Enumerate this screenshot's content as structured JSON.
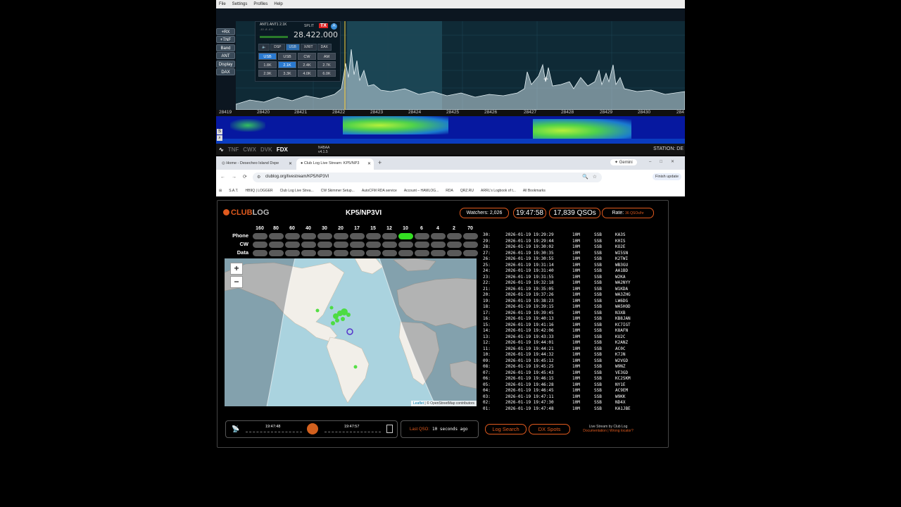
{
  "sdr": {
    "menu": [
      "File",
      "Settings",
      "Profiles",
      "Help"
    ],
    "side_buttons": [
      "+RX",
      "+TNF",
      "Band",
      "ANT",
      "Display",
      "DAX"
    ],
    "slice": {
      "ant": "ANT1 ANT1 2.1K",
      "sub": "-10 -8 -4 0",
      "split": "SPLIT",
      "tx": "TX",
      "letter": "A",
      "frequency": "28.422.000",
      "tabs": [
        "DSP",
        "USB",
        "X/RIT",
        "DAX"
      ],
      "filters": [
        "USB",
        "USB",
        "CW",
        "AM",
        "1.8K",
        "2.1K",
        "2.4K",
        "2.7K",
        "2.9K",
        "3.3K",
        "4.0K",
        "6.0K"
      ]
    },
    "freq_labels": [
      "28419",
      "28420",
      "28421",
      "28422",
      "28423",
      "28424",
      "28425",
      "28426",
      "28427",
      "28428",
      "28429",
      "28430",
      "284"
    ],
    "status": [
      "TNF",
      "CWX",
      "DVK",
      "FDX"
    ],
    "callsign": "N4BAA",
    "version": "v4.1.5",
    "station": "STATION: DE"
  },
  "browser": {
    "tabs": [
      {
        "title": "Home - Desecheo Island Dxpe"
      },
      {
        "title": "Club Log Live Stream: KP5/NP3"
      }
    ],
    "gemini": "Gemini",
    "url": "clublog.org/livestream/KP5/NP3VI",
    "finish_update": "Finish update",
    "bookmarks": [
      "S.A.T.",
      "HB9Q | LOGGER",
      "Club Log Live Strea...",
      "CW Skimmer Setup...",
      "AutoCFM RDA service",
      "Account – HAMLOG...",
      "RDA",
      "QRZ.RU",
      "ARRL's Logbook of t...",
      "All Bookmarks"
    ]
  },
  "clublog": {
    "logo_club": "CLUB",
    "logo_log": "LOG",
    "callsign": "KP5/NP3VI",
    "watchers": "Watchers: 2,026",
    "clock": "19:47:58",
    "qsos": "17,839 QSOs",
    "rate_label": "Rate:",
    "rate_value": "36 QSOs/hr",
    "bands": [
      "160",
      "80",
      "60",
      "40",
      "30",
      "20",
      "17",
      "15",
      "12",
      "10",
      "6",
      "4",
      "2",
      "70"
    ],
    "modes": [
      "Phone",
      "CW",
      "Data"
    ],
    "active": {
      "mode": "Phone",
      "band": "10"
    },
    "zoom_in": "+",
    "zoom_out": "−",
    "attribution_leaflet": "Leaflet",
    "attribution_rest": "| © OpenStreetMap contributors",
    "log": [
      {
        "n": "30:",
        "t": "2026-01-19 19:29:29",
        "b": "10M",
        "m": "SSB",
        "c": "KA3S"
      },
      {
        "n": "29:",
        "t": "2026-01-19 19:29:44",
        "b": "10M",
        "m": "SSB",
        "c": "K0IS"
      },
      {
        "n": "28:",
        "t": "2026-01-19 19:30:02",
        "b": "10M",
        "m": "SSB",
        "c": "KO2E"
      },
      {
        "n": "27:",
        "t": "2026-01-19 19:30:35",
        "b": "10M",
        "m": "SSB",
        "c": "WI5SN"
      },
      {
        "n": "26:",
        "t": "2026-01-19 19:30:55",
        "b": "10M",
        "m": "SSB",
        "c": "K2TWI"
      },
      {
        "n": "25:",
        "t": "2026-01-19 19:31:14",
        "b": "10M",
        "m": "SSB",
        "c": "WB3GU"
      },
      {
        "n": "24:",
        "t": "2026-01-19 19:31:40",
        "b": "10M",
        "m": "SSB",
        "c": "AA1BD"
      },
      {
        "n": "23:",
        "t": "2026-01-19 19:31:55",
        "b": "10M",
        "m": "SSB",
        "c": "W2KA"
      },
      {
        "n": "22:",
        "t": "2026-01-19 19:32:18",
        "b": "10M",
        "m": "SSB",
        "c": "WA2NYY"
      },
      {
        "n": "21:",
        "t": "2026-01-19 19:35:05",
        "b": "10M",
        "m": "SSB",
        "c": "W1KDA"
      },
      {
        "n": "20:",
        "t": "2026-01-19 19:37:26",
        "b": "10M",
        "m": "SSB",
        "c": "WA3ZHG"
      },
      {
        "n": "19:",
        "t": "2026-01-19 19:38:23",
        "b": "10M",
        "m": "SSB",
        "c": "LW6DG"
      },
      {
        "n": "18:",
        "t": "2026-01-19 19:39:15",
        "b": "10M",
        "m": "SSB",
        "c": "WA5HOD"
      },
      {
        "n": "17:",
        "t": "2026-01-19 19:39:45",
        "b": "10M",
        "m": "SSB",
        "c": "N3XB"
      },
      {
        "n": "16:",
        "t": "2026-01-19 19:40:13",
        "b": "10M",
        "m": "SSB",
        "c": "KB8JAN"
      },
      {
        "n": "15:",
        "t": "2026-01-19 19:41:16",
        "b": "10M",
        "m": "SSB",
        "c": "KC7IGT"
      },
      {
        "n": "14:",
        "t": "2026-01-19 19:42:06",
        "b": "10M",
        "m": "SSB",
        "c": "K8AFN"
      },
      {
        "n": "13:",
        "t": "2026-01-19 19:43:33",
        "b": "10M",
        "m": "SSB",
        "c": "KU2C"
      },
      {
        "n": "12:",
        "t": "2026-01-19 19:44:01",
        "b": "10M",
        "m": "SSB",
        "c": "K2ANZ"
      },
      {
        "n": "11:",
        "t": "2026-01-19 19:44:21",
        "b": "10M",
        "m": "SSB",
        "c": "AC0C"
      },
      {
        "n": "10:",
        "t": "2026-01-19 19:44:32",
        "b": "10M",
        "m": "SSB",
        "c": "K7JN"
      },
      {
        "n": "09:",
        "t": "2026-01-19 19:45:12",
        "b": "10M",
        "m": "SSB",
        "c": "W2VGD"
      },
      {
        "n": "08:",
        "t": "2026-01-19 19:45:25",
        "b": "10M",
        "m": "SSB",
        "c": "W9NZ"
      },
      {
        "n": "07:",
        "t": "2026-01-19 19:45:43",
        "b": "10M",
        "m": "SSB",
        "c": "VE3GD"
      },
      {
        "n": "06:",
        "t": "2026-01-19 19:46:15",
        "b": "10M",
        "m": "SSB",
        "c": "KC2SKM"
      },
      {
        "n": "05:",
        "t": "2026-01-19 19:46:28",
        "b": "10M",
        "m": "SSB",
        "c": "NY1E"
      },
      {
        "n": "04:",
        "t": "2026-01-19 19:46:45",
        "b": "10M",
        "m": "SSB",
        "c": "AC9EM"
      },
      {
        "n": "03:",
        "t": "2026-01-19 19:47:11",
        "b": "10M",
        "m": "SSB",
        "c": "W9KK"
      },
      {
        "n": "02:",
        "t": "2026-01-19 19:47:30",
        "b": "10M",
        "m": "SSB",
        "c": "ND4X"
      },
      {
        "n": "01:",
        "t": "2026-01-19 19:47:48",
        "b": "10M",
        "m": "SSB",
        "c": "KA1JBE"
      }
    ],
    "player": {
      "time_left": "19:47:48",
      "time_right": "19:47:57"
    },
    "last_qso_label": "Last QSO:",
    "last_qso_value": "10 seconds ago",
    "log_search": "Log Search",
    "dx_spots": "DX Spots",
    "footer_line1": "Live Stream by Club Log",
    "footer_line2": "Documentation | Wrong locator?"
  }
}
